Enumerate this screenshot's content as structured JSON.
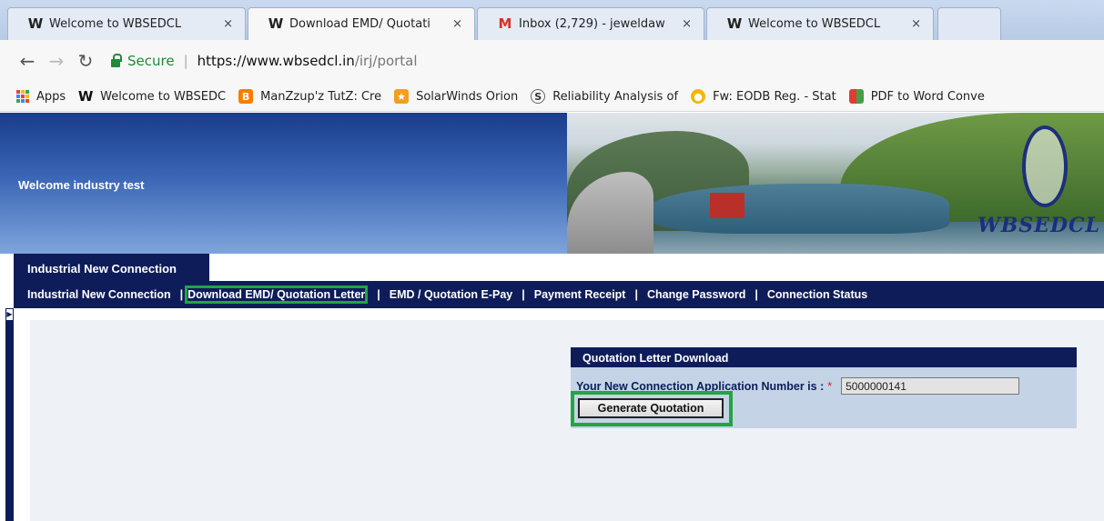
{
  "browser": {
    "tabs": [
      {
        "title": "Welcome to WBSEDCL",
        "icon": "wbsedcl-favicon-icon",
        "active": false
      },
      {
        "title": "Download EMD/ Quotati",
        "icon": "wbsedcl-favicon-icon",
        "active": true
      },
      {
        "title": "Inbox (2,729) - jeweldaw",
        "icon": "gmail-icon",
        "active": false
      },
      {
        "title": "Welcome to WBSEDCL",
        "icon": "wbsedcl-favicon-icon",
        "active": false
      }
    ],
    "close_glyph": "×",
    "address": {
      "secure_label": "Secure",
      "separator": "|",
      "url_host": "https://www.wbsedcl.in",
      "url_path": "/irj/portal"
    },
    "bookmarks": [
      {
        "label": "Apps",
        "icon": "apps-grid-icon"
      },
      {
        "label": "Welcome to WBSEDC",
        "icon": "wbsedcl-favicon-icon"
      },
      {
        "label": "ManZzup'z TutZ: Cre",
        "icon": "blogger-icon"
      },
      {
        "label": "SolarWinds Orion",
        "icon": "solarwinds-icon"
      },
      {
        "label": "Reliability Analysis of",
        "icon": "research-icon"
      },
      {
        "label": "Fw: EODB Reg. - Stat",
        "icon": "mail-coin-icon"
      },
      {
        "label": "PDF to Word Conve",
        "icon": "pdf-converter-icon"
      }
    ]
  },
  "banner": {
    "welcome_text": "Welcome industry test",
    "logo_text": "WBSEDCL"
  },
  "nav": {
    "top_tab": "Industrial New Connection",
    "items": [
      "Industrial New Connection",
      "Download EMD/ Quotation Letter",
      "EMD / Quotation E-Pay",
      "Payment Receipt",
      "Change Password",
      "Connection Status"
    ],
    "separator": "|"
  },
  "panel": {
    "title": "Quotation Letter Download",
    "field_label": "Your New Connection Application Number is :",
    "required_mark": "*",
    "field_value": "5000000141",
    "button_label": "Generate Quotation"
  },
  "colors": {
    "portal_navy": "#0e1d5a",
    "highlight_green": "#22a542",
    "panel_bg": "#c5d3e7",
    "secure_green": "#1f8a3a"
  }
}
